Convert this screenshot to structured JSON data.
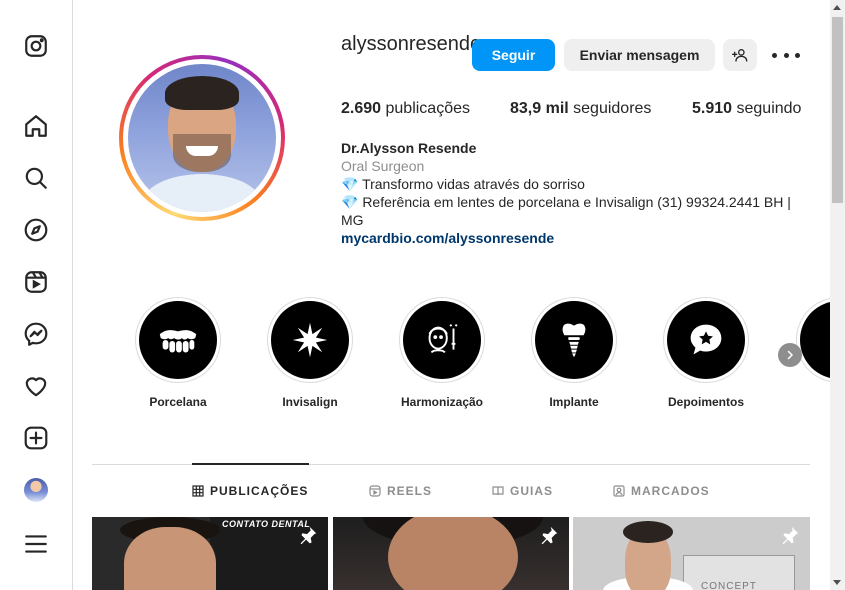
{
  "nav": {
    "items": [
      "instagram-logo",
      "home",
      "search",
      "explore",
      "reels",
      "messenger",
      "notifications",
      "create",
      "profile",
      "more"
    ]
  },
  "profile": {
    "username": "alyssonresende",
    "follow_label": "Seguir",
    "message_label": "Enviar mensagem",
    "stats": {
      "posts_count": "2.690",
      "posts_label": "publicações",
      "followers_count": "83,9 mil",
      "followers_label": "seguidores",
      "following_count": "5.910",
      "following_label": "seguindo"
    },
    "bio": {
      "name": "Dr.Alysson Resende",
      "category": "Oral Surgeon",
      "line1": "💎 Transformo vidas através do sorriso",
      "line2": "💎 Referência em lentes de porcelana e Invisalign (31) 99324.2441 BH | MG",
      "link": "mycardbio.com/alyssonresende"
    }
  },
  "highlights": [
    {
      "label": "Porcelana",
      "icon": "teeth-icon"
    },
    {
      "label": "Invisalign",
      "icon": "flower-icon"
    },
    {
      "label": "Harmonização",
      "icon": "face-injection-icon"
    },
    {
      "label": "Implante",
      "icon": "implant-icon"
    },
    {
      "label": "Depoimentos",
      "icon": "star-chat-icon"
    }
  ],
  "tabs": [
    {
      "label": "PUBLICAÇÕES",
      "active": true
    },
    {
      "label": "REELS",
      "active": false
    },
    {
      "label": "GUIAS",
      "active": false
    },
    {
      "label": "MARCADOS",
      "active": false
    }
  ],
  "posts": [
    {
      "overlay_text": "CONTATO DENTAL",
      "pinned": true
    },
    {
      "overlay_text": "",
      "pinned": true
    },
    {
      "overlay_text": "CONCEPT",
      "pinned": true
    }
  ],
  "colors": {
    "primary_button": "#0095f6",
    "secondary_button": "#efefef",
    "link": "#00376b",
    "muted": "#8e8e8e"
  }
}
